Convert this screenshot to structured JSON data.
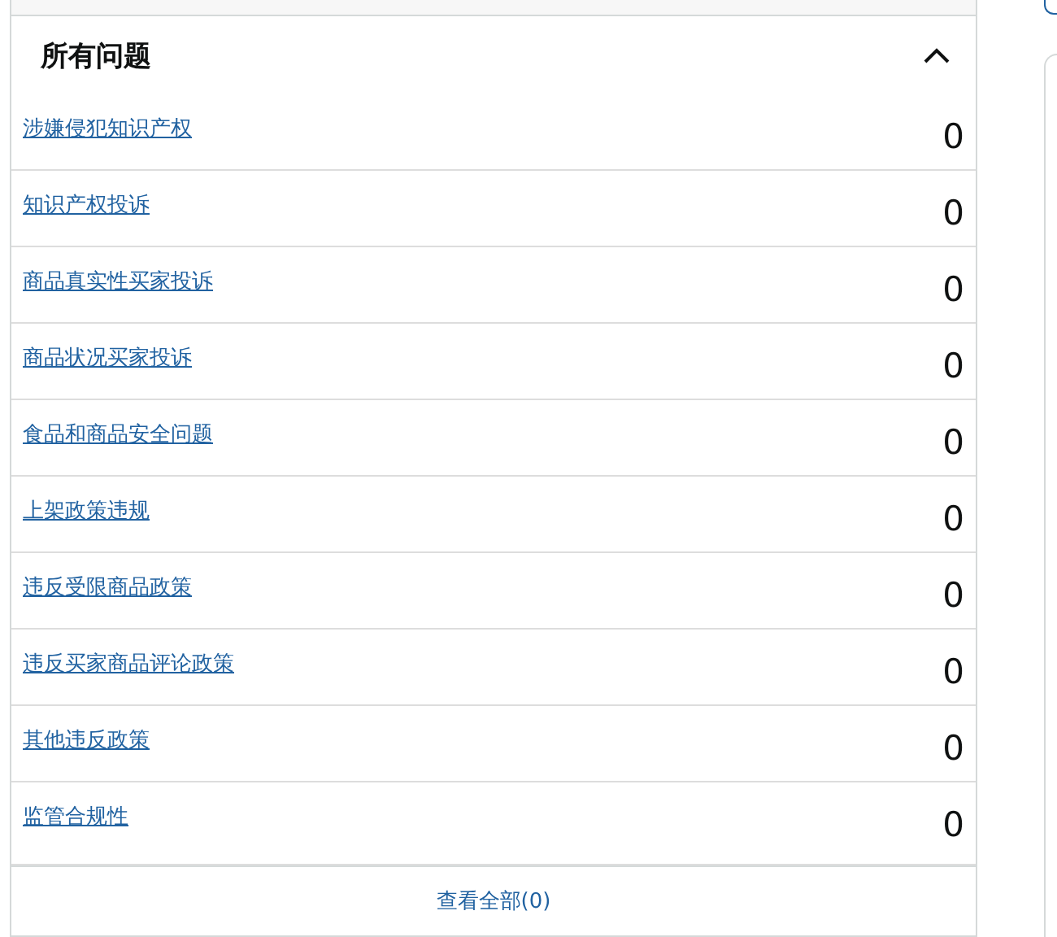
{
  "section": {
    "title": "所有问题",
    "expanded": true
  },
  "issues": [
    {
      "label": "涉嫌侵犯知识产权",
      "count": "0"
    },
    {
      "label": "知识产权投诉",
      "count": "0"
    },
    {
      "label": "商品真实性买家投诉",
      "count": "0"
    },
    {
      "label": "商品状况买家投诉",
      "count": "0"
    },
    {
      "label": "食品和商品安全问题",
      "count": "0"
    },
    {
      "label": "上架政策违规",
      "count": "0"
    },
    {
      "label": "违反受限商品政策",
      "count": "0"
    },
    {
      "label": "违反买家商品评论政策",
      "count": "0"
    },
    {
      "label": "其他违反政策",
      "count": "0"
    },
    {
      "label": "监管合规性",
      "count": "0"
    }
  ],
  "footer_link": "查看全部(0)"
}
